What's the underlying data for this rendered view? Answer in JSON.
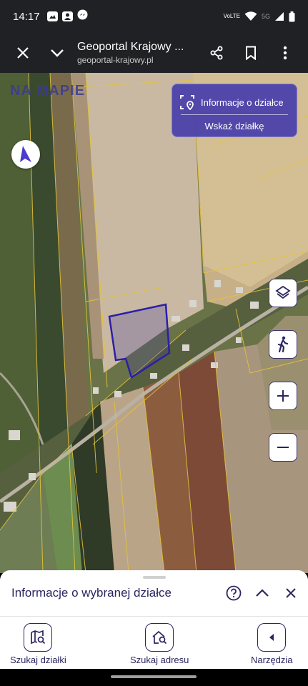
{
  "status_bar": {
    "time": "14:17",
    "network_label": "VoLTE",
    "network_gen": "5G",
    "notification_icons": [
      "gallery-notification-icon",
      "contact-notification-icon",
      "messenger-notification-icon"
    ]
  },
  "browser": {
    "title": "Geoportal Krajowy ...",
    "url": "geoportal-krajowy.pl",
    "icons": [
      "close-icon",
      "chevron-down-icon",
      "share-icon",
      "bookmark-icon",
      "more-vert-icon"
    ]
  },
  "map": {
    "logo_text": "NA MAPIE",
    "info_panel": {
      "title": "Informacje o działce",
      "action": "Wskaż działkę"
    },
    "controls": [
      "layers-icon",
      "walking-person-icon",
      "zoom-in-icon",
      "zoom-out-icon"
    ],
    "colors": {
      "parcel_outline": "#f0c830",
      "selected_parcel": "#2b1fa8",
      "panel_bg": "#463eaa"
    }
  },
  "sheet": {
    "title": "Informacje o wybranej działce"
  },
  "bottom_nav": {
    "items": [
      {
        "label": "Szukaj działki",
        "icon": "map-search-icon"
      },
      {
        "label": "Szukaj adresu",
        "icon": "home-search-icon"
      },
      {
        "label": "Narzędzia",
        "icon": "arrow-left-icon"
      }
    ]
  }
}
